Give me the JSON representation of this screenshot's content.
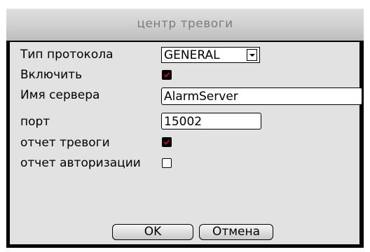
{
  "dialog": {
    "title": "центр тревоги"
  },
  "form": {
    "protocol_label": "Тип протокола",
    "protocol_value": "GENERAL",
    "enable_label": "Включить",
    "enable_checked": true,
    "server_label": "Имя сервера",
    "server_value": "AlarmServer",
    "port_label": "порт",
    "port_value": "15002",
    "alarm_report_label": "отчет тревоги",
    "alarm_report_checked": true,
    "auth_report_label": "отчет авторизации",
    "auth_report_checked": false
  },
  "buttons": {
    "ok_label": "OK",
    "cancel_label": "Отмена"
  },
  "colors": {
    "checkmark": "#b01020",
    "title_text": "#7c7c7c",
    "panel_bg": "#e2e2e2"
  },
  "icons": {
    "dropdown": "chevron-down-icon",
    "check": "checkmark-icon"
  }
}
